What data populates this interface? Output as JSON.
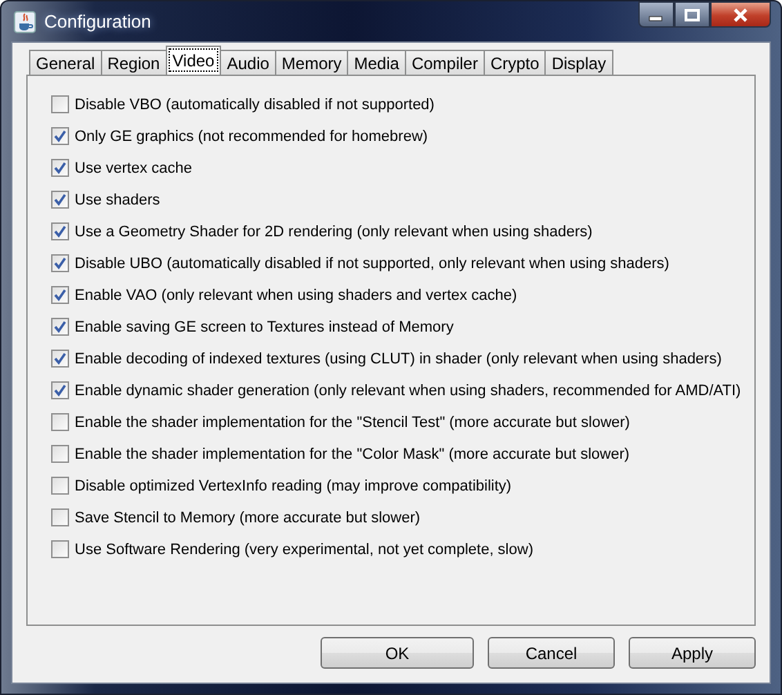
{
  "window": {
    "title": "Configuration"
  },
  "tabs": [
    {
      "label": "General",
      "selected": false
    },
    {
      "label": "Region",
      "selected": false
    },
    {
      "label": "Video",
      "selected": true
    },
    {
      "label": "Audio",
      "selected": false
    },
    {
      "label": "Memory",
      "selected": false
    },
    {
      "label": "Media",
      "selected": false
    },
    {
      "label": "Compiler",
      "selected": false
    },
    {
      "label": "Crypto",
      "selected": false
    },
    {
      "label": "Display",
      "selected": false
    }
  ],
  "options": [
    {
      "label": "Disable VBO (automatically disabled if not supported)",
      "checked": false
    },
    {
      "label": "Only GE graphics (not recommended for homebrew)",
      "checked": true
    },
    {
      "label": "Use vertex cache",
      "checked": true
    },
    {
      "label": "Use shaders",
      "checked": true
    },
    {
      "label": "Use a Geometry Shader for 2D rendering (only relevant when using shaders)",
      "checked": true
    },
    {
      "label": "Disable UBO (automatically disabled if not supported, only relevant when using shaders)",
      "checked": true
    },
    {
      "label": "Enable VAO (only relevant when using shaders and vertex cache)",
      "checked": true
    },
    {
      "label": "Enable saving GE screen to Textures instead of Memory",
      "checked": true
    },
    {
      "label": "Enable decoding of indexed textures (using CLUT) in shader (only relevant when using shaders)",
      "checked": true
    },
    {
      "label": "Enable dynamic shader generation (only relevant when using shaders, recommended for AMD/ATI)",
      "checked": true
    },
    {
      "label": "Enable the shader implementation for the \"Stencil Test\" (more accurate but slower)",
      "checked": false
    },
    {
      "label": "Enable the shader implementation for the \"Color Mask\" (more accurate but slower)",
      "checked": false
    },
    {
      "label": "Disable optimized VertexInfo reading (may improve compatibility)",
      "checked": false
    },
    {
      "label": "Save Stencil to Memory (more accurate but slower)",
      "checked": false
    },
    {
      "label": "Use Software Rendering (very experimental, not yet complete, slow)",
      "checked": false
    }
  ],
  "buttons": [
    "OK",
    "Cancel",
    "Apply"
  ]
}
